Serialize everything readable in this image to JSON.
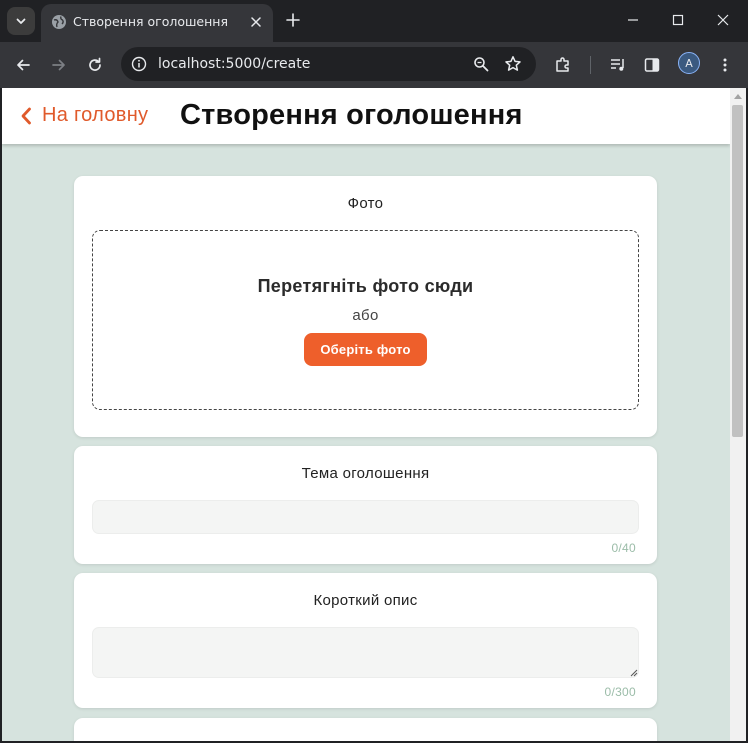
{
  "browser": {
    "tab": {
      "title": "Створення оголошення"
    },
    "address": {
      "url": "localhost:5000/create"
    },
    "profile": {
      "initial": "A"
    }
  },
  "header": {
    "back_label": "На головну",
    "title": "Створення оголошення"
  },
  "photo_section": {
    "label": "Фото",
    "drop_title": "Перетягніть фото сюди",
    "or_text": "або",
    "choose_button": "Оберіть фото"
  },
  "topic_section": {
    "label": "Тема оголошення",
    "value": "",
    "counter": "0/40"
  },
  "short_desc_section": {
    "label": "Короткий опис",
    "value": "",
    "counter": "0/300"
  },
  "colors": {
    "accent": "#ee5f2b",
    "page_background": "#d6e3de",
    "counter_text": "#9bbca8"
  }
}
